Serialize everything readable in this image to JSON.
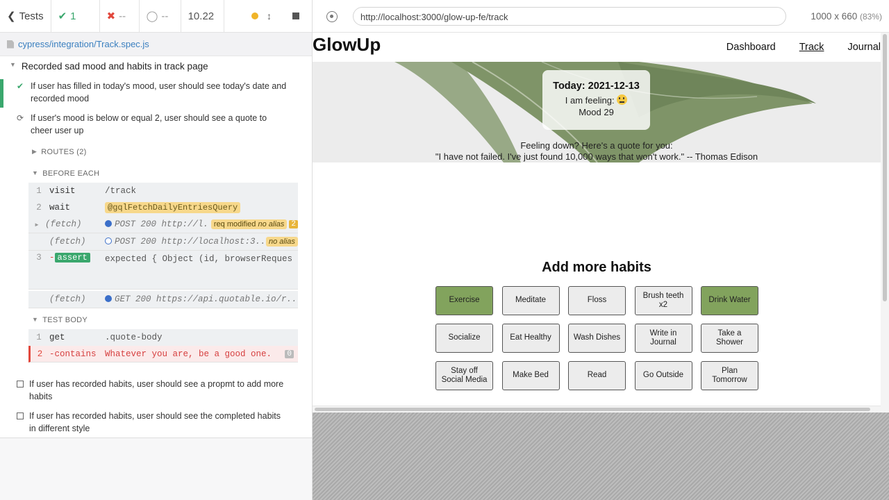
{
  "topbar": {
    "back_label": "Tests",
    "passed": "1",
    "failed": "--",
    "pending": "--",
    "duration": "10.22"
  },
  "spec": {
    "path": "cypress/integration/Track.spec.js"
  },
  "suite": {
    "title": "Recorded sad mood and habits in track page"
  },
  "tests": [
    {
      "title": "If user has filled in today's mood, user should see today's date and recorded mood",
      "state": "passed"
    },
    {
      "title": "If user's mood is below or equal 2, user should see a quote to cheer user up",
      "state": "running"
    },
    {
      "title": "If user has recorded habits, user should see a propmt to add more habits",
      "state": "pending"
    },
    {
      "title": "If user has recorded habits, user should see the completed habits in different style",
      "state": "pending"
    }
  ],
  "hooks": {
    "routes": "ROUTES (2)",
    "before_each": "BEFORE EACH",
    "test_body": "TEST BODY"
  },
  "before_each_commands": [
    {
      "num": "1",
      "name": "visit",
      "msg": "/track"
    },
    {
      "num": "2",
      "name": "wait",
      "msg": "@gqlFetchDailyEntriesQuery"
    },
    {
      "num": "",
      "name": "(fetch)",
      "msg": "POST 200 http://l...",
      "badge": "req modified",
      "badge2": "no alias",
      "count": "2"
    },
    {
      "num": "",
      "name": "(fetch)",
      "msg": "POST 200 http://localhost:3...",
      "badge": "no alias"
    },
    {
      "num": "3",
      "name": "-assert",
      "msg": "expected { Object (id, browserRequestId, ...) } to be an object"
    },
    {
      "num": "",
      "name": "(fetch)",
      "msg": "GET 200 https://api.quotable.io/r..."
    }
  ],
  "test_body_commands": [
    {
      "num": "1",
      "name": "get",
      "msg": ".quote-body"
    },
    {
      "num": "2",
      "name": "-contains",
      "msg": "Whatever you are, be a good one.",
      "count": "0"
    }
  ],
  "browser": {
    "url": "http://localhost:3000/glow-up-fe/track",
    "viewport": "1000 x 660",
    "scale": "(83%)"
  },
  "app": {
    "brand": "GlowUp",
    "nav": [
      "Dashboard",
      "Track",
      "Journal"
    ],
    "active_nav": "Track",
    "mood_card": {
      "date": "Today: 2021-12-13",
      "feeling": "I am feeling: ",
      "mood": "Mood 29"
    },
    "quote": {
      "intro": "Feeling down? Here's a quote for you:",
      "text": "\"I have not failed. I've just found 10,000 ways that won't work.\" -- Thomas Edison"
    },
    "habits_title": "Add more habits",
    "habits": [
      {
        "label": "Exercise",
        "done": true
      },
      {
        "label": "Meditate",
        "done": false
      },
      {
        "label": "Floss",
        "done": false
      },
      {
        "label": "Brush teeth x2",
        "done": false
      },
      {
        "label": "Drink Water",
        "done": true
      },
      {
        "label": "Socialize",
        "done": false
      },
      {
        "label": "Eat Healthy",
        "done": false
      },
      {
        "label": "Wash Dishes",
        "done": false
      },
      {
        "label": "Write in Journal",
        "done": false
      },
      {
        "label": "Take a Shower",
        "done": false
      },
      {
        "label": "Stay off Social Media",
        "done": false
      },
      {
        "label": "Make Bed",
        "done": false
      },
      {
        "label": "Read",
        "done": false
      },
      {
        "label": "Go Outside",
        "done": false
      },
      {
        "label": "Plan Tomorrow",
        "done": false
      }
    ],
    "colors": {
      "done_habit": "#82a35d",
      "pass": "#3aa76d",
      "fail": "#e2483d"
    }
  }
}
